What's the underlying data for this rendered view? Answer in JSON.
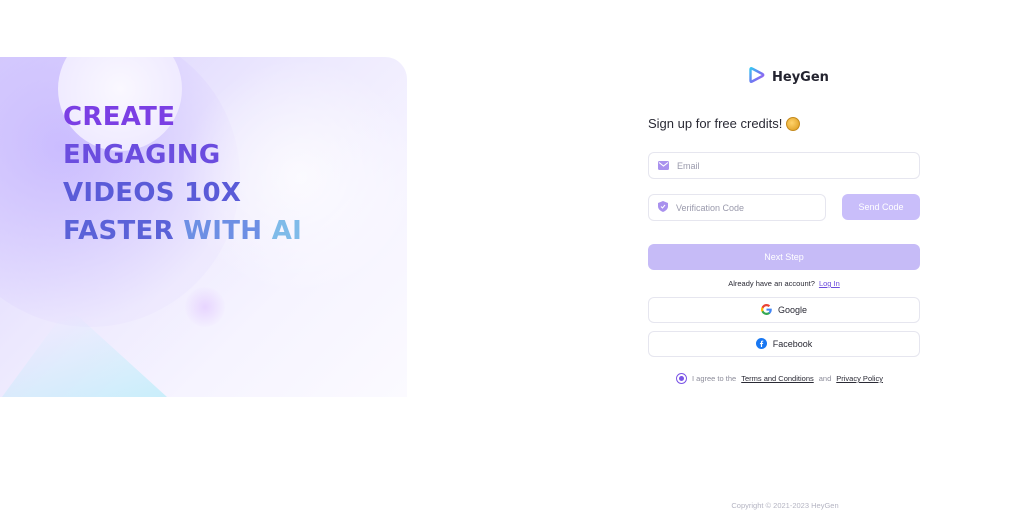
{
  "hero": {
    "lines": [
      "CREATE",
      "ENGAGING",
      "VIDEOS 10X"
    ],
    "line4_part1": "FASTER ",
    "line4_part2": "WITH ",
    "line4_part3": "AI"
  },
  "brand": {
    "name": "HeyGen",
    "icon": "heygen-logo-icon"
  },
  "form": {
    "heading": "Sign up for free credits!",
    "heading_emoji": "waving-hand-emoji",
    "email_placeholder": "Email",
    "code_placeholder": "Verification Code",
    "send_code_label": "Send Code",
    "next_step_label": "Next Step",
    "already_text": "Already have an account?",
    "login_link": "Log In",
    "google_label": "Google",
    "facebook_label": "Facebook",
    "agree_text": "I agree to the",
    "terms_link": "Terms and Conditions",
    "and_text": "and",
    "privacy_link": "Privacy Policy"
  },
  "footer": {
    "copyright": "Copyright © 2021-2023 HeyGen"
  },
  "colors": {
    "accent": "#7b55e6",
    "button_disabled": "#c6bbf7",
    "hero_purple": "#7b3fe4",
    "hero_blue": "#7fbbe9"
  }
}
